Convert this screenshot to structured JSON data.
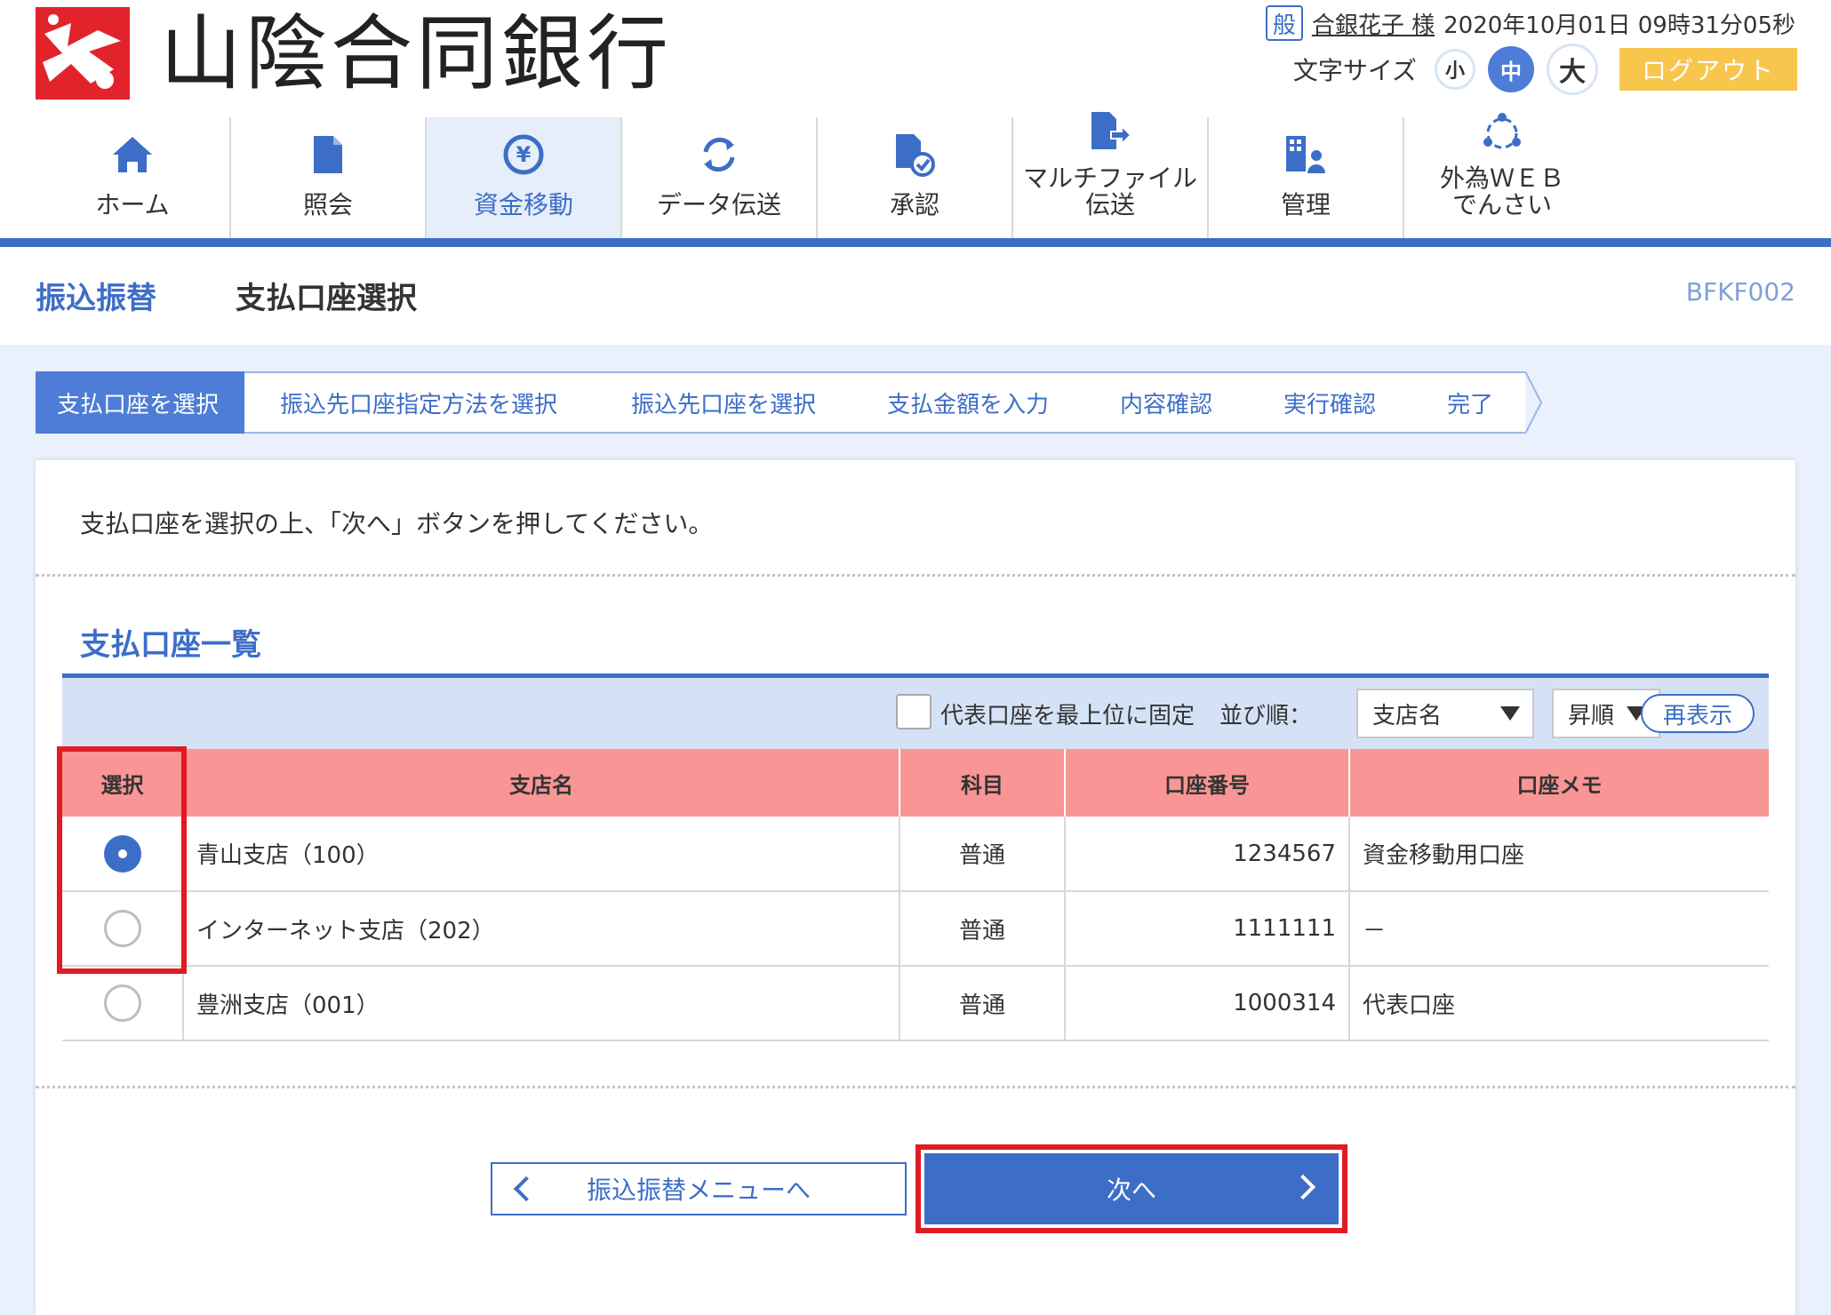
{
  "header": {
    "bank_name": "山陰合同銀行",
    "user_kind": "般",
    "user_name": "合銀花子 様",
    "datetime": "2020年10月01日 09時31分05秒",
    "font_size_label": "文字サイズ",
    "font_small": "小",
    "font_medium": "中",
    "font_large": "大",
    "logout": "ログアウト"
  },
  "nav": {
    "items": [
      {
        "label": "ホーム",
        "icon": "home-icon"
      },
      {
        "label": "照会",
        "icon": "document-icon"
      },
      {
        "label": "資金移動",
        "icon": "yen-transfer-icon"
      },
      {
        "label": "データ伝送",
        "icon": "refresh-icon"
      },
      {
        "label": "承認",
        "icon": "approve-document-icon"
      },
      {
        "label": "マルチファイル\n伝送",
        "icon": "file-send-icon"
      },
      {
        "label": "管理",
        "icon": "admin-icon"
      },
      {
        "label": "外為ＷＥＢ\nでんさい",
        "icon": "network-icon"
      }
    ],
    "active_index": 2
  },
  "page": {
    "title_main": "振込振替",
    "title_sub": "支払口座選択",
    "screen_id": "BFKF002"
  },
  "steps": [
    "支払口座を選択",
    "振込先口座指定方法を選択",
    "振込先口座を選択",
    "支払金額を入力",
    "内容確認",
    "実行確認",
    "完了"
  ],
  "instruction": "支払口座を選択の上、「次へ」ボタンを押してください。",
  "list": {
    "title": "支払口座一覧",
    "pin_label": "代表口座を最上位に固定",
    "sort_label": "並び順：",
    "sort_field": "支店名",
    "sort_order": "昇順",
    "redisplay": "再表示",
    "columns": [
      "選択",
      "支店名",
      "科目",
      "口座番号",
      "口座メモ"
    ],
    "rows": [
      {
        "selected": true,
        "branch": "青山支店（100）",
        "type": "普通",
        "number": "1234567",
        "memo": "資金移動用口座"
      },
      {
        "selected": false,
        "branch": "インターネット支店（202）",
        "type": "普通",
        "number": "1111111",
        "memo": "－"
      },
      {
        "selected": false,
        "branch": "豊洲支店（001）",
        "type": "普通",
        "number": "1000314",
        "memo": "代表口座"
      }
    ]
  },
  "buttons": {
    "back": "振込振替メニューへ",
    "next": "次へ"
  },
  "colors": {
    "primary": "#3d6ec7",
    "header_row": "#f99595",
    "highlight": "#e01b24",
    "logout": "#f8c64c",
    "brand_red": "#e3232c"
  }
}
